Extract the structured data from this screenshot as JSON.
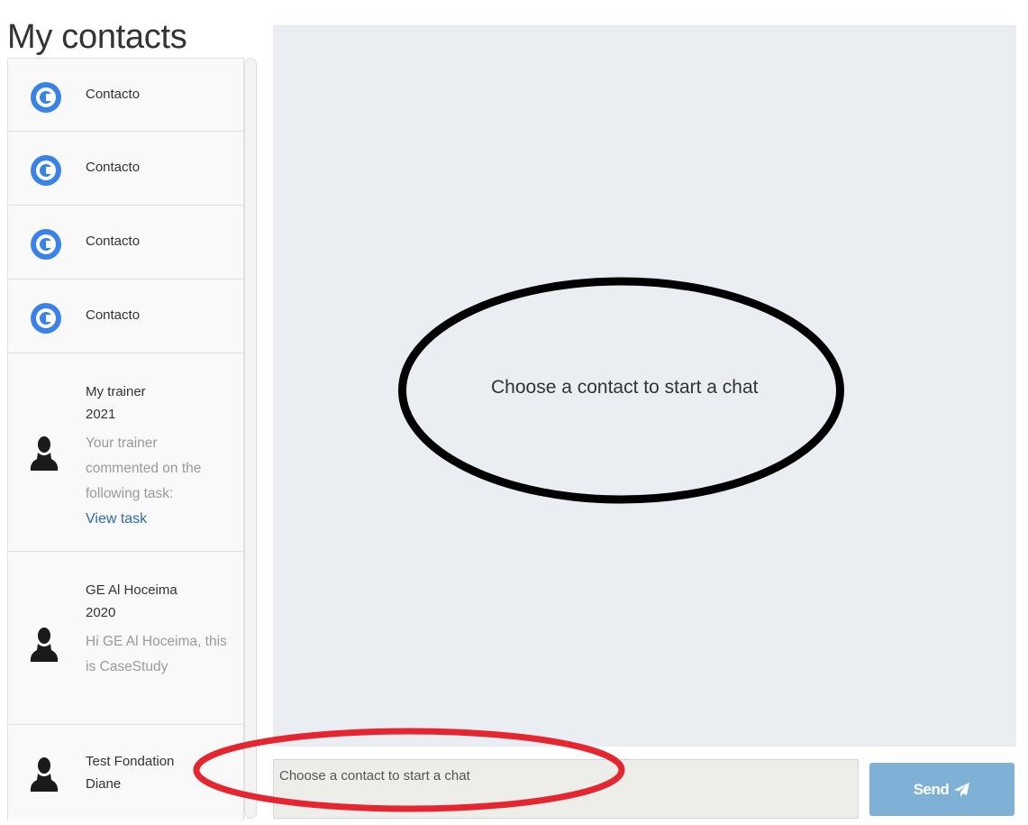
{
  "page": {
    "title": "My contacts"
  },
  "contacts": [
    {
      "name": "Contacto",
      "avatar": "contacto-logo-icon"
    },
    {
      "name": "Contacto",
      "avatar": "contacto-logo-icon"
    },
    {
      "name": "Contacto",
      "avatar": "contacto-logo-icon"
    },
    {
      "name": "Contacto",
      "avatar": "contacto-logo-icon"
    },
    {
      "name": "My trainer",
      "year": "2021",
      "avatar": "person-icon",
      "preview": "Your trainer commented on the following task:",
      "link": "View task"
    },
    {
      "name": "GE Al Hoceima",
      "year": "2020",
      "avatar": "person-icon",
      "preview": "Hi GE Al Hoceima, this is CaseStudy"
    },
    {
      "name": "Test Fondation",
      "year": "Diane",
      "avatar": "person-icon"
    }
  ],
  "chat": {
    "empty_message": "Choose a contact to start a chat",
    "input_placeholder": "Choose a contact to start a chat",
    "send_label": "Send"
  },
  "colors": {
    "chat_background": "#eaedf2",
    "send_button": "#7fb1d6",
    "link": "#2f6aa8",
    "logo_blue": "#3b82e8",
    "annotation_black": "#000000",
    "annotation_red": "#e52530"
  }
}
